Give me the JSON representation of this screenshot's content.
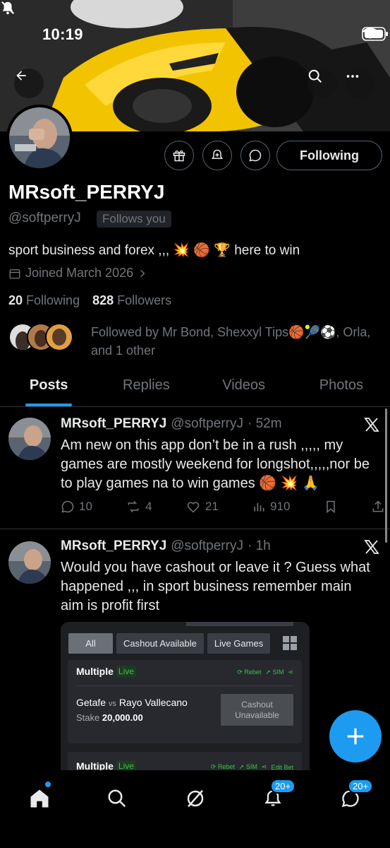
{
  "status_bar": {
    "time": "10:19"
  },
  "header_buttons": {
    "back_icon": "arrow-left-icon",
    "search_icon": "search-icon",
    "more_icon": "more-icon"
  },
  "profile": {
    "display_name": "MRsoft_PERRYJ",
    "handle": "@softperryJ",
    "follows_you": "Follows you",
    "bio": "sport business and forex ,,, 💥 🏀 🏆 here to win",
    "joined": "Joined March 2026",
    "following_count": "20",
    "following_label": "Following",
    "followers_count": "828",
    "followers_label": "Followers",
    "followed_by": "Followed by Mr Bond, Shexxyl Tips🏀🎾⚽, Orla, and 1 other",
    "follow_button": "Following"
  },
  "tabs": [
    "Posts",
    "Replies",
    "Videos",
    "Photos"
  ],
  "posts": [
    {
      "name": "MRsoft_PERRYJ",
      "handle": "@softperryJ",
      "time": "· 52m",
      "text": "Am new on this app don’t be in a rush ,,,,, my games are mostly weekend for longshot,,,,,nor be to play games na to win games 🏀 💥 🙏",
      "replies": "10",
      "reposts": "4",
      "likes": "21",
      "views": "910"
    },
    {
      "name": "MRsoft_PERRYJ",
      "handle": "@softperryJ",
      "time": "· 1h",
      "text": "Would you have cashout or leave it ? Guess what happened ,,, in sport business remember main aim is profit first"
    }
  ],
  "embed": {
    "tabs": [
      "All",
      "Cashout Available",
      "Live Games"
    ],
    "card1": {
      "title": "Multiple",
      "live": "Live",
      "rebet": "Rebet",
      "sim": "SIM",
      "match_home": "Getafe",
      "vs": "vs",
      "match_away": "Rayo Vallecano",
      "stake_label": "Stake",
      "stake_value": "20,000.00",
      "cashout": "Cashout Unavailable"
    },
    "card2": {
      "title": "Multiple",
      "live": "Live",
      "rebet": "Rebet",
      "sim": "SIM",
      "edit": "Edit Bet"
    }
  },
  "bottom_nav": {
    "notifications_badge": "20+",
    "messages_badge": "20+"
  },
  "colors": {
    "accent": "#1d9bf0",
    "muted": "#71767b",
    "border": "#2f3336"
  }
}
